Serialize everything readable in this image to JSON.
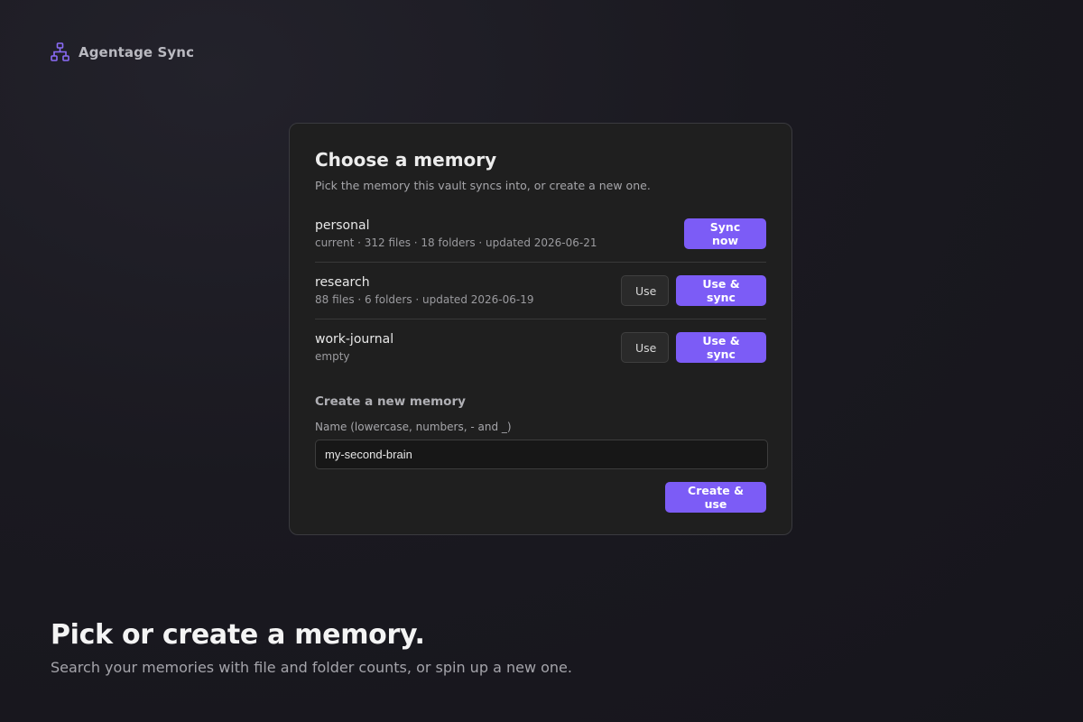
{
  "app": {
    "name": "Agentage Sync",
    "icon": "sitemap-icon",
    "accent_color": "#7c5cf6"
  },
  "card": {
    "title": "Choose a memory",
    "subtitle": "Pick the memory this vault syncs into, or create a new one.",
    "memories": [
      {
        "name": "personal",
        "meta": "current · 312 files · 18 folders · updated 2026-06-21",
        "sync_label": "Sync now"
      },
      {
        "name": "research",
        "meta": "88 files · 6 folders · updated 2026-06-19",
        "use_label": "Use",
        "use_sync_label": "Use & sync"
      },
      {
        "name": "work-journal",
        "meta": "empty",
        "use_label": "Use",
        "use_sync_label": "Use & sync"
      }
    ],
    "create": {
      "heading": "Create a new memory",
      "field_label": "Name (lowercase, numbers, - and _)",
      "input_value": "my-second-brain",
      "button_label": "Create & use"
    }
  },
  "hero": {
    "title": "Pick or create a memory.",
    "subtitle": "Search your memories with file and folder counts, or spin up a new one."
  }
}
